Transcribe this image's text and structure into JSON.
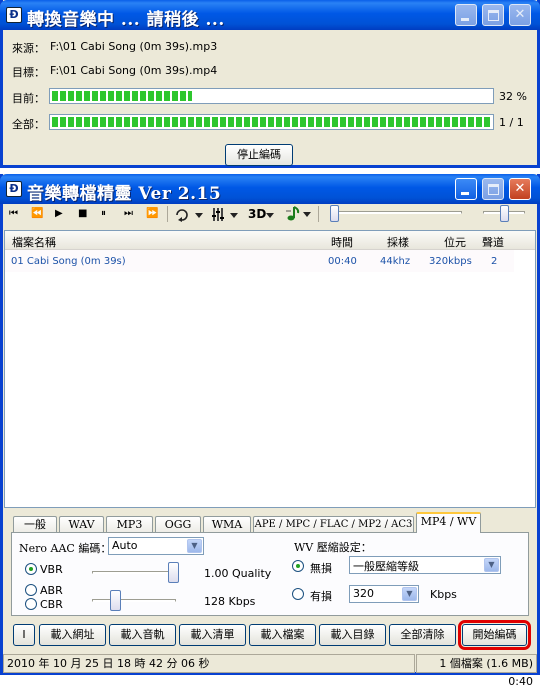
{
  "convert_window": {
    "title": "轉換音樂中 ... 請稍後 ...",
    "app_icon": "Ð",
    "source_label": "來源：",
    "source_value": "F:\\01 Cabi Song (0m 39s).mp3",
    "target_label": "目標：",
    "target_value": "F:\\01 Cabi Song (0m 39s).mp4",
    "current_label": "目前：",
    "current_progress": 0.32,
    "current_percent": "32 %",
    "total_label": "全部：",
    "total_progress": 1.0,
    "total_count": "1 / 1",
    "stop_button": "停止編碼"
  },
  "main_window": {
    "title": "音樂轉檔精靈 Ver 2.15",
    "app_icon": "Ð",
    "toolbar": {
      "buttons": [
        "⏮",
        "⏪",
        "▶",
        "■",
        "⏸",
        "⏭",
        "⏩"
      ],
      "repeat_icon": "refresh-icon",
      "eq_icon": "equalizer-icon",
      "mode_3d": "3D",
      "note_icon": "music-note-icon"
    },
    "list": {
      "headers": {
        "name": "檔案名稱",
        "time": "時間",
        "sample": "採樣",
        "bitrate": "位元",
        "channels": "聲道"
      },
      "rows": [
        {
          "name": "01 Cabi Song (0m 39s)",
          "time": "00:40",
          "sample": "44khz",
          "bitrate": "320kbps",
          "channels": "2"
        }
      ]
    },
    "tabs": [
      "一般",
      "WAV",
      "MP3",
      "OGG",
      "WMA",
      "APE / MPC / FLAC / MP2 / AC3",
      "MP4 / WV"
    ],
    "active_tab": "MP4 / WV",
    "settings": {
      "nero_label": "Nero AAC 編碼：",
      "nero_value": "Auto",
      "vbr_label": "VBR",
      "vbr_quality": "1.00 Quality",
      "abr_label": "ABR",
      "cbr_label": "CBR",
      "cbr_kbps": "128 Kbps",
      "wv_label": "WV 壓縮設定：",
      "lossless_label": "無損",
      "lossless_value": "一般壓縮等級",
      "lossy_label": "有損",
      "lossy_value": "320",
      "lossy_unit": "Kbps"
    },
    "buttons": {
      "info": "I",
      "load_url": "載入網址",
      "load_audio": "載入音軌",
      "load_list": "載入清單",
      "load_file": "載入檔案",
      "load_dir": "載入目錄",
      "clear_all": "全部清除",
      "start": "開始編碼"
    },
    "status": {
      "datetime": "2010 年 10 月 25 日 18 時 42 分 06 秒",
      "summary": "1 個檔案 (1.6 MB) 0:40"
    }
  },
  "colors": {
    "titlebar": "#0058e6",
    "progress": "#2ec62e",
    "highlight": "#e00000",
    "list_text": "#1c52a8",
    "tab_accent": "#ffc83c"
  }
}
